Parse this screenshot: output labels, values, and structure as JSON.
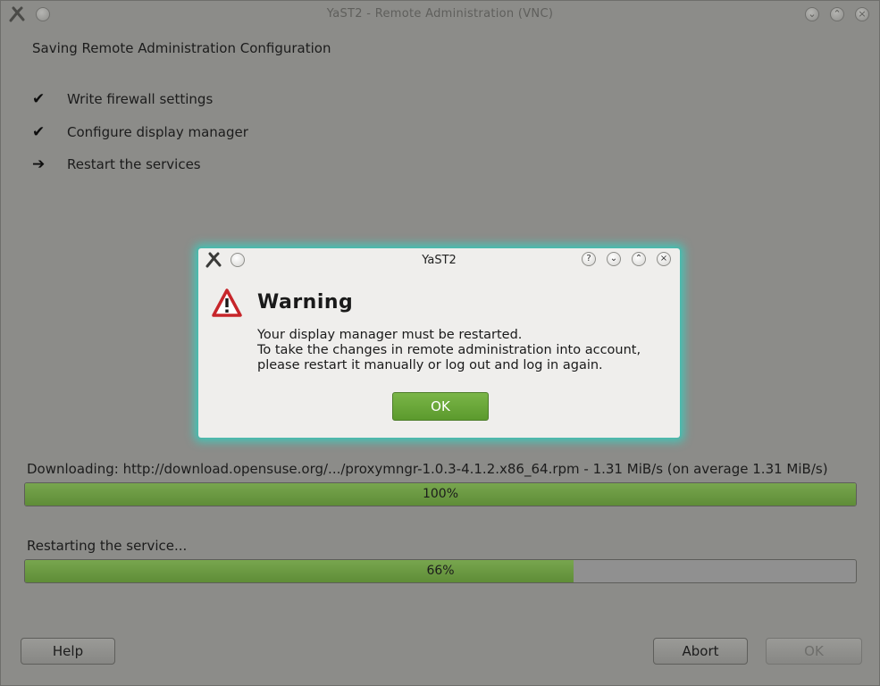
{
  "window": {
    "title": "YaST2 - Remote Administration (VNC)",
    "heading": "Saving Remote Administration Configuration",
    "titlebar_buttons": [
      "minimize",
      "maximize",
      "close"
    ]
  },
  "steps": [
    {
      "icon": "check",
      "symbol": "✔",
      "label": "Write firewall settings"
    },
    {
      "icon": "check",
      "symbol": "✔",
      "label": "Configure display manager"
    },
    {
      "icon": "arrow",
      "symbol": "➔",
      "label": "Restart the services"
    }
  ],
  "progress": [
    {
      "label": "Downloading: http://download.opensuse.org/.../proxymngr-1.0.3-4.1.2.x86_64.rpm - 1.31 MiB/s (on average 1.31 MiB/s)",
      "value": 100,
      "text": "100%"
    },
    {
      "label": "Restarting the service...",
      "value": 66,
      "text": "66%"
    }
  ],
  "buttons": {
    "help": "Help",
    "abort": "Abort",
    "ok": "OK"
  },
  "dialog": {
    "title": "YaST2",
    "heading": "Warning",
    "lines": [
      "Your display manager must be restarted.",
      "To take the changes in remote administration into account,",
      "please restart it manually or log out and log in again."
    ],
    "ok": "OK",
    "help_glyph": "?"
  },
  "colors": {
    "progress_fill": "#6a9a40",
    "dialog_glow": "#4ac2b4",
    "ok_button": "#6aa63a",
    "warning": "#c7262b"
  }
}
